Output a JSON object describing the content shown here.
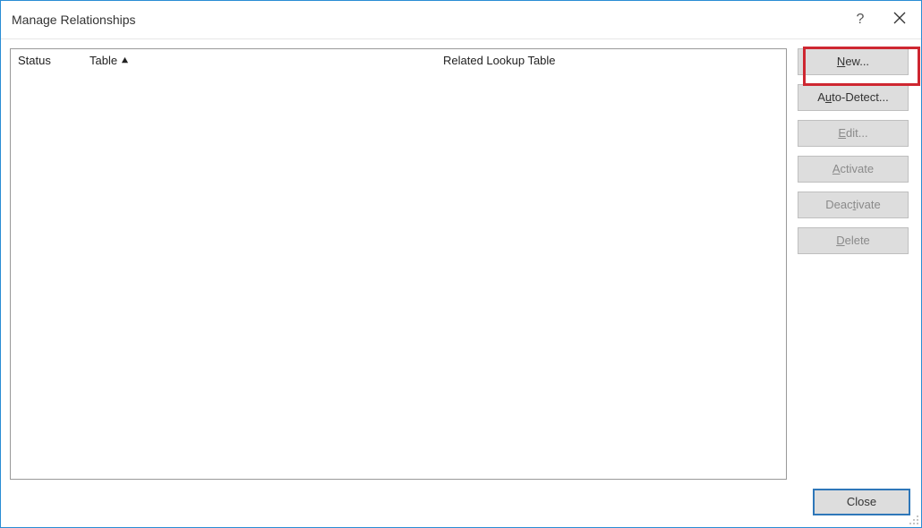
{
  "titlebar": {
    "title": "Manage Relationships",
    "help_symbol": "?"
  },
  "table": {
    "columns": {
      "status": "Status",
      "table": "Table",
      "related": "Related Lookup Table"
    },
    "rows": []
  },
  "buttons": {
    "new": {
      "prefix": "",
      "underline": "N",
      "suffix": "ew..."
    },
    "auto_detect": {
      "prefix": "A",
      "underline": "u",
      "suffix": "to-Detect..."
    },
    "edit": {
      "prefix": "",
      "underline": "E",
      "suffix": "dit..."
    },
    "activate": {
      "prefix": "",
      "underline": "A",
      "suffix": "ctivate"
    },
    "deactivate": {
      "prefix": "Deac",
      "underline": "t",
      "suffix": "ivate"
    },
    "delete": {
      "prefix": "",
      "underline": "D",
      "suffix": "elete"
    }
  },
  "footer": {
    "close": "Close"
  }
}
